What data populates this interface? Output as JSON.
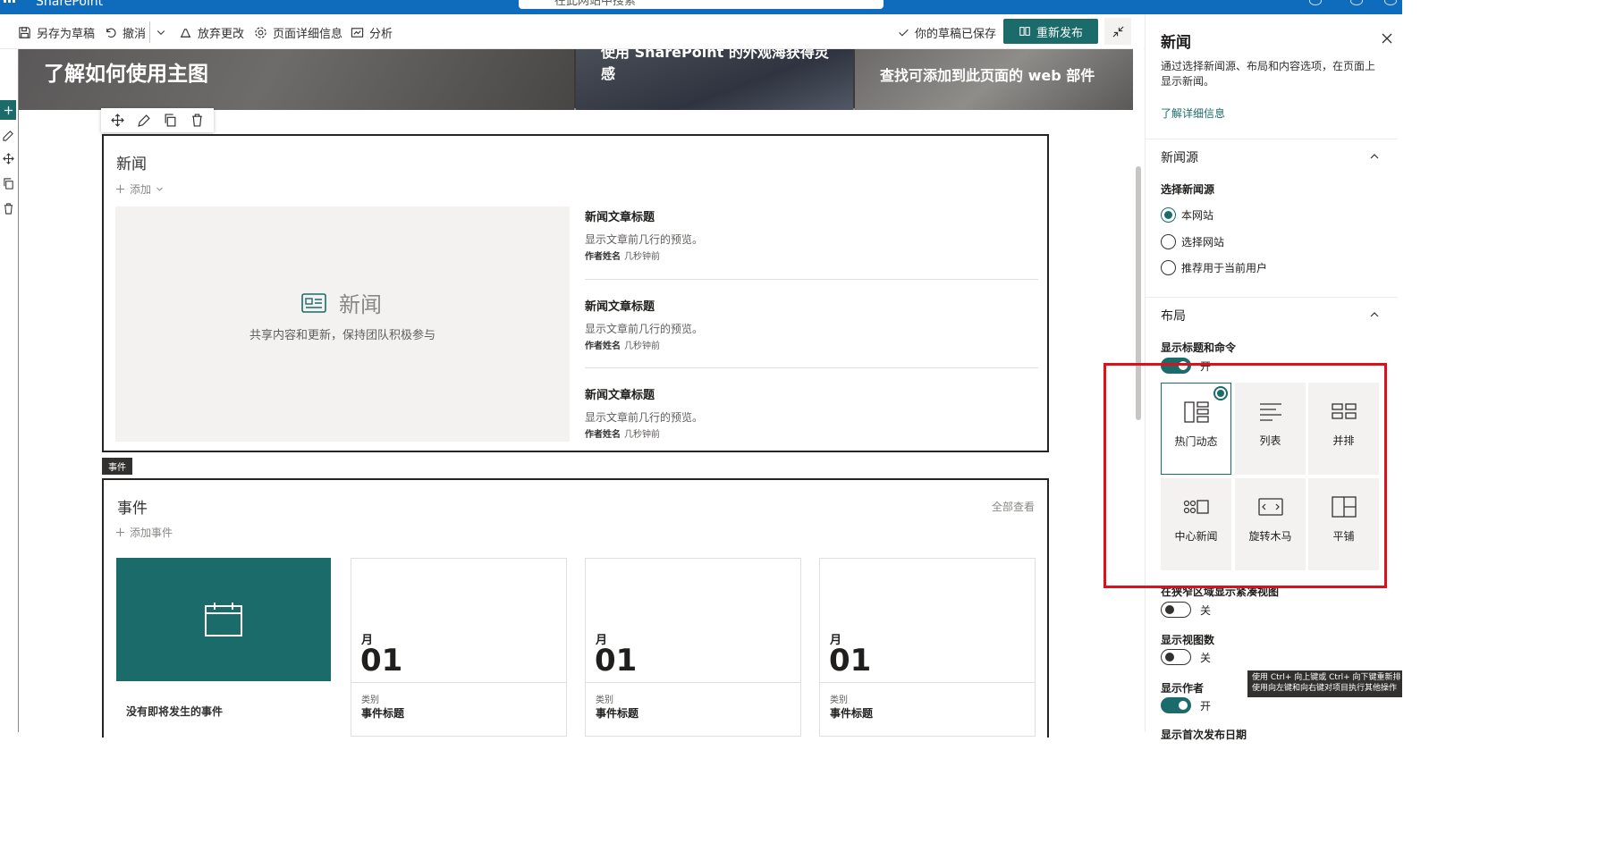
{
  "suite": {
    "app_name": "SharePoint",
    "search_placeholder": "在此网站中搜索"
  },
  "commandbar": {
    "save_draft": "另存为草稿",
    "undo": "撤消",
    "discard": "放弃更改",
    "page_details": "页面详细信息",
    "analytics": "分析",
    "saved_status": "你的草稿已保存",
    "republish": "重新发布"
  },
  "hero": {
    "tile1": "了解如何使用主图",
    "tile2": "使用 SharePoint 的外观海获得灵感",
    "tile3": "查找可添加到此页面的 web 部件"
  },
  "news": {
    "title": "新闻",
    "add": "添加",
    "placeholder_title": "新闻",
    "placeholder_desc": "共享内容和更新，保持团队积极参与",
    "articles": [
      {
        "title": "新闻文章标题",
        "desc": "显示文章前几行的预览。",
        "author": "作者姓名",
        "time": "几秒钟前"
      },
      {
        "title": "新闻文章标题",
        "desc": "显示文章前几行的预览。",
        "author": "作者姓名",
        "time": "几秒钟前"
      },
      {
        "title": "新闻文章标题",
        "desc": "显示文章前几行的预览。",
        "author": "作者姓名",
        "time": "几秒钟前"
      }
    ]
  },
  "section_tag": "事件",
  "events": {
    "title": "事件",
    "add": "添加事件",
    "see_all": "全部查看",
    "empty": "没有即将发生的事件",
    "cards": [
      {
        "month": "月",
        "day": "01",
        "category": "类别",
        "title": "事件标题"
      },
      {
        "month": "月",
        "day": "01",
        "category": "类别",
        "title": "事件标题"
      },
      {
        "month": "月",
        "day": "01",
        "category": "类别",
        "title": "事件标题"
      }
    ]
  },
  "pane": {
    "title": "新闻",
    "description": "通过选择新闻源、布局和内容选项，在页面上显示新闻。",
    "learn_more": "了解详细信息",
    "source_group": "新闻源",
    "source_label": "选择新闻源",
    "sources": [
      "本网站",
      "选择网站",
      "推荐用于当前用户"
    ],
    "selected_source": "本网站",
    "layout_group": "布局",
    "show_title_label": "显示标题和命令",
    "show_title_state": "开",
    "layouts": [
      "热门动态",
      "列表",
      "并排",
      "中心新闻",
      "旋转木马",
      "平铺"
    ],
    "selected_layout": "热门动态",
    "compact_label": "在狭窄区域显示紧凑视图",
    "compact_state": "关",
    "views_label": "显示视图数",
    "views_state": "关",
    "author_label": "显示作者",
    "author_state": "开",
    "date_label": "显示首次发布日期"
  },
  "tooltip": {
    "line1": "使用 Ctrl+ 向上键或 Ctrl+ 向下键重新排",
    "line2": "使用向左键和向右键对项目执行其他操作"
  },
  "colors": {
    "accent": "#1b6b6b",
    "suite": "#0f6cbd",
    "highlight": "#d9121b"
  }
}
